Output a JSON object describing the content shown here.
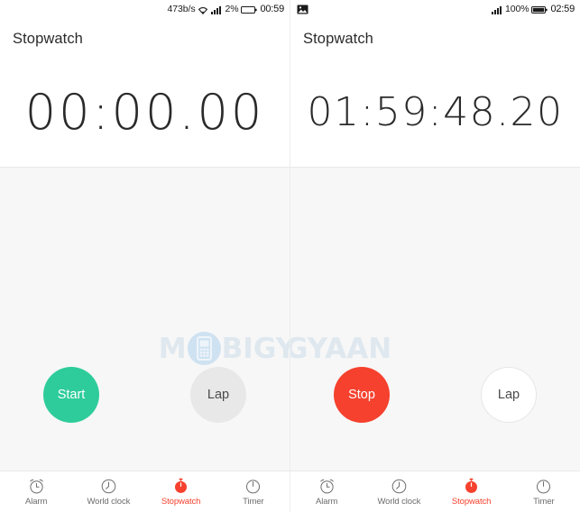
{
  "colors": {
    "accent_green": "#2ecc9b",
    "accent_red": "#f5412d",
    "body_bg": "#f7f7f7",
    "nav_inactive": "#6d6d6d",
    "watermark": "#dfe8ef"
  },
  "watermark": {
    "text_before": "M",
    "icon": "mobile-phone-icon",
    "text_after": "BIGYAAN"
  },
  "screens": [
    {
      "id": "left",
      "statusbar": {
        "network_speed": "473b/s",
        "wifi_icon": "wifi-icon",
        "signal_icon": "signal-bars-icon",
        "battery_percent": "2%",
        "battery_icon": "battery-empty-icon",
        "clock": "00:59"
      },
      "title": "Stopwatch",
      "timer": "00:00.00",
      "timer_size": "small",
      "primary_button": {
        "label": "Start",
        "color": "#2ecc9b",
        "name": "start-button"
      },
      "lap_button": {
        "label": "Lap",
        "style": "grey",
        "name": "lap-button"
      },
      "nav": [
        {
          "label": "Alarm",
          "icon": "alarm-clock-icon",
          "active": false
        },
        {
          "label": "World clock",
          "icon": "world-clock-icon",
          "active": false
        },
        {
          "label": "Stopwatch",
          "icon": "stopwatch-icon",
          "active": true
        },
        {
          "label": "Timer",
          "icon": "timer-icon",
          "active": false
        }
      ]
    },
    {
      "id": "right",
      "statusbar": {
        "notification_icon": "screenshot-image-icon",
        "signal_icon": "signal-bars-icon",
        "battery_percent": "100%",
        "battery_icon": "battery-full-icon",
        "clock": "02:59"
      },
      "title": "Stopwatch",
      "timer": "01:59:48.20",
      "timer_size": "long",
      "primary_button": {
        "label": "Stop",
        "color": "#f5412d",
        "name": "stop-button"
      },
      "lap_button": {
        "label": "Lap",
        "style": "white",
        "name": "lap-button"
      },
      "nav": [
        {
          "label": "Alarm",
          "icon": "alarm-clock-icon",
          "active": false
        },
        {
          "label": "World clock",
          "icon": "world-clock-icon",
          "active": false
        },
        {
          "label": "Stopwatch",
          "icon": "stopwatch-icon",
          "active": true
        },
        {
          "label": "Timer",
          "icon": "timer-icon",
          "active": false
        }
      ]
    }
  ]
}
